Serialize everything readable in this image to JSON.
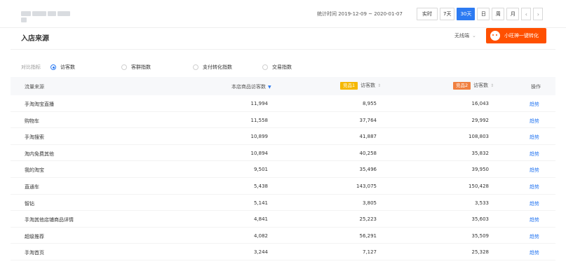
{
  "topbar": {
    "stat_time": "统计时间 2019-12-09 ~ 2020-01-07",
    "periods": [
      "实时",
      "7天",
      "30天",
      "日",
      "周",
      "月"
    ],
    "active_period": "30天",
    "prev_label": "‹",
    "next_label": "›"
  },
  "section": {
    "title": "入店来源",
    "view_select": "无线端",
    "convert_button": "小旺神一键转化"
  },
  "metrics": {
    "label": "对比指标",
    "options": [
      "访客数",
      "客群指数",
      "支付转化指数",
      "交易指数"
    ],
    "selected": "访客数"
  },
  "table": {
    "headers": {
      "source": "流量来源",
      "own": "本店商品访客数",
      "comp1_badge": "竞品1",
      "comp1": "访客数",
      "comp2_badge": "竞品2",
      "comp2": "访客数",
      "action": "操作"
    },
    "badge_colors": {
      "comp1": "#f5b800",
      "comp2": "#f08040"
    },
    "rows": [
      {
        "source": "手淘淘宝直播",
        "own": "11,994",
        "comp1": "8,955",
        "comp2": "16,043",
        "action": "趋势"
      },
      {
        "source": "购物车",
        "own": "11,558",
        "comp1": "37,764",
        "comp2": "29,992",
        "action": "趋势"
      },
      {
        "source": "手淘搜索",
        "own": "10,899",
        "comp1": "41,887",
        "comp2": "108,803",
        "action": "趋势"
      },
      {
        "source": "淘内免费其他",
        "own": "10,894",
        "comp1": "40,258",
        "comp2": "35,832",
        "action": "趋势"
      },
      {
        "source": "我的淘宝",
        "own": "9,501",
        "comp1": "35,496",
        "comp2": "39,950",
        "action": "趋势"
      },
      {
        "source": "直通车",
        "own": "5,438",
        "comp1": "143,075",
        "comp2": "150,428",
        "action": "趋势"
      },
      {
        "source": "智钻",
        "own": "5,141",
        "comp1": "3,805",
        "comp2": "3,533",
        "action": "趋势"
      },
      {
        "source": "手淘其他店铺商品详情",
        "own": "4,841",
        "comp1": "25,223",
        "comp2": "35,603",
        "action": "趋势"
      },
      {
        "source": "超级推荐",
        "own": "4,082",
        "comp1": "56,291",
        "comp2": "35,509",
        "action": "趋势"
      },
      {
        "source": "手淘首页",
        "own": "3,244",
        "comp1": "7,127",
        "comp2": "25,328",
        "action": "趋势"
      }
    ]
  },
  "colors": {
    "accent": "#2d7bf2",
    "brand": "#ff5000"
  }
}
